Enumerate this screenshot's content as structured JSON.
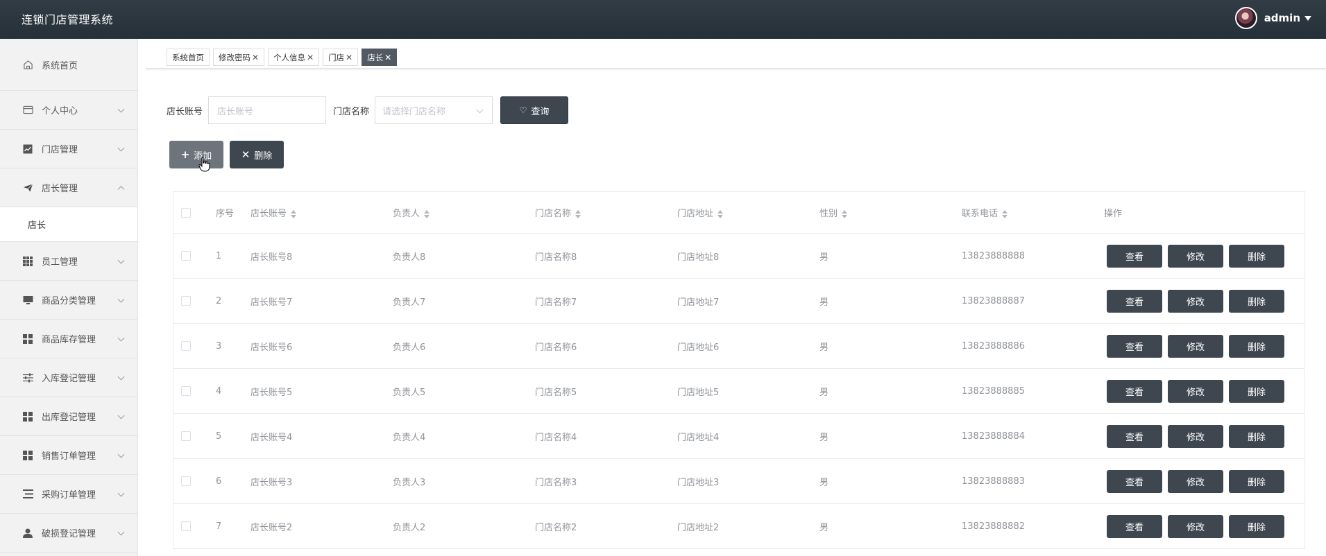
{
  "header": {
    "title": "连锁门店管理系统",
    "user": "admin"
  },
  "sidebar": {
    "items": [
      {
        "label": "系统首页",
        "icon": "home-icon"
      },
      {
        "label": "个人中心",
        "icon": "card-icon"
      },
      {
        "label": "门店管理",
        "icon": "chart-icon"
      },
      {
        "label": "店长管理",
        "icon": "send-icon",
        "expanded": true
      },
      {
        "label": "员工管理",
        "icon": "grid-icon"
      },
      {
        "label": "商品分类管理",
        "icon": "monitor-icon"
      },
      {
        "label": "商品库存管理",
        "icon": "apps-icon"
      },
      {
        "label": "入库登记管理",
        "icon": "sliders-icon"
      },
      {
        "label": "出库登记管理",
        "icon": "apps-icon"
      },
      {
        "label": "销售订单管理",
        "icon": "apps-icon"
      },
      {
        "label": "采购订单管理",
        "icon": "list-icon"
      },
      {
        "label": "破损登记管理",
        "icon": "user-icon"
      }
    ],
    "sub_item": "店长"
  },
  "tabs": [
    {
      "label": "系统首页",
      "closable": false
    },
    {
      "label": "修改密码",
      "closable": true
    },
    {
      "label": "个人信息",
      "closable": true
    },
    {
      "label": "门店",
      "closable": true
    },
    {
      "label": "店长",
      "closable": true,
      "active": true
    }
  ],
  "search": {
    "account_label": "店长账号",
    "account_placeholder": "店长账号",
    "store_label": "门店名称",
    "store_placeholder": "请选择门店名称",
    "query_button": "查询"
  },
  "actions": {
    "add": "添加",
    "delete": "删除"
  },
  "table": {
    "headers": [
      "序号",
      "店长账号",
      "负责人",
      "门店名称",
      "门店地址",
      "性别",
      "联系电话",
      "操作"
    ],
    "rows": [
      [
        "1",
        "店长账号8",
        "负责人8",
        "门店名称8",
        "门店地址8",
        "男",
        "13823888888"
      ],
      [
        "2",
        "店长账号7",
        "负责人7",
        "门店名称7",
        "门店地址7",
        "男",
        "13823888887"
      ],
      [
        "3",
        "店长账号6",
        "负责人6",
        "门店名称6",
        "门店地址6",
        "男",
        "13823888886"
      ],
      [
        "4",
        "店长账号5",
        "负责人5",
        "门店名称5",
        "门店地址5",
        "男",
        "13823888885"
      ],
      [
        "5",
        "店长账号4",
        "负责人4",
        "门店名称4",
        "门店地址4",
        "男",
        "13823888884"
      ],
      [
        "6",
        "店长账号3",
        "负责人3",
        "门店名称3",
        "门店地址3",
        "男",
        "13823888883"
      ],
      [
        "7",
        "店长账号2",
        "负责人2",
        "门店名称2",
        "门店地址2",
        "男",
        "13823888882"
      ]
    ],
    "row_buttons": [
      "查看",
      "修改",
      "删除"
    ]
  }
}
